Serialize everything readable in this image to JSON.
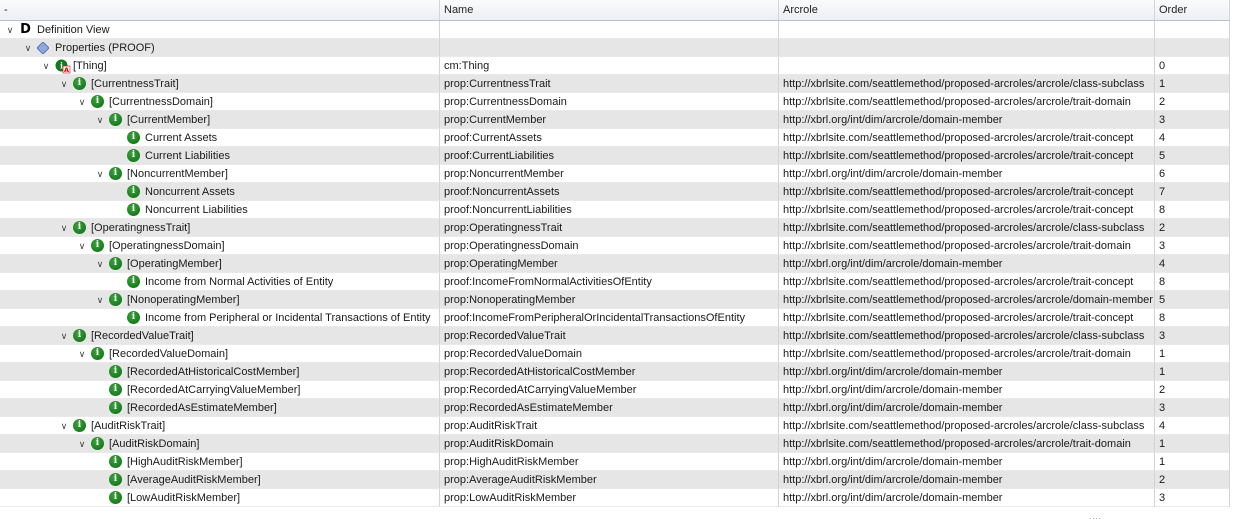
{
  "header": {
    "col_tree": "-",
    "col_name": "Name",
    "col_arcrole": "Arcrole",
    "col_order": "Order"
  },
  "colors": {
    "icon_green": "#0b6b12",
    "row_alt": "#e6e6e6",
    "header_border": "#b9c3cf"
  },
  "rows": [
    {
      "label": "Definition View",
      "name": "",
      "arcrole": "",
      "order": "",
      "icon": "definition-view-icon",
      "chev": "expanded"
    },
    {
      "label": "Properties (PROOF)",
      "name": "",
      "arcrole": "",
      "order": "",
      "icon": "diamond-icon",
      "chev": "expanded"
    },
    {
      "label": "[Thing]",
      "name": "cm:Thing",
      "arcrole": "",
      "order": "0",
      "icon": "abstract-element-icon",
      "chev": "expanded"
    },
    {
      "label": "[CurrentnessTrait]",
      "name": "prop:CurrentnessTrait",
      "arcrole": "http://xbrlsite.com/seattlemethod/proposed-arcroles/arcrole/class-subclass",
      "order": "1",
      "icon": "info-icon",
      "chev": "expanded"
    },
    {
      "label": "[CurrentnessDomain]",
      "name": "prop:CurrentnessDomain",
      "arcrole": "http://xbrlsite.com/seattlemethod/proposed-arcroles/arcrole/trait-domain",
      "order": "2",
      "icon": "info-icon",
      "chev": "expanded"
    },
    {
      "label": "[CurrentMember]",
      "name": "prop:CurrentMember",
      "arcrole": "http://xbrl.org/int/dim/arcrole/domain-member",
      "order": "3",
      "icon": "info-icon",
      "chev": "expanded"
    },
    {
      "label": "Current Assets",
      "name": "proof:CurrentAssets",
      "arcrole": "http://xbrlsite.com/seattlemethod/proposed-arcroles/arcrole/trait-concept",
      "order": "4",
      "icon": "info-icon",
      "chev": ""
    },
    {
      "label": "Current Liabilities",
      "name": "proof:CurrentLiabilities",
      "arcrole": "http://xbrlsite.com/seattlemethod/proposed-arcroles/arcrole/trait-concept",
      "order": "5",
      "icon": "info-icon",
      "chev": ""
    },
    {
      "label": "[NoncurrentMember]",
      "name": "prop:NoncurrentMember",
      "arcrole": "http://xbrl.org/int/dim/arcrole/domain-member",
      "order": "6",
      "icon": "info-icon",
      "chev": "expanded"
    },
    {
      "label": "Noncurrent Assets",
      "name": "proof:NoncurrentAssets",
      "arcrole": "http://xbrlsite.com/seattlemethod/proposed-arcroles/arcrole/trait-concept",
      "order": "7",
      "icon": "info-icon",
      "chev": ""
    },
    {
      "label": "Noncurrent Liabilities",
      "name": "proof:NoncurrentLiabilities",
      "arcrole": "http://xbrlsite.com/seattlemethod/proposed-arcroles/arcrole/trait-concept",
      "order": "8",
      "icon": "info-icon",
      "chev": ""
    },
    {
      "label": "[OperatingnessTrait]",
      "name": "prop:OperatingnessTrait",
      "arcrole": "http://xbrlsite.com/seattlemethod/proposed-arcroles/arcrole/class-subclass",
      "order": "2",
      "icon": "info-icon",
      "chev": "expanded"
    },
    {
      "label": "[OperatingnessDomain]",
      "name": "prop:OperatingnessDomain",
      "arcrole": "http://xbrlsite.com/seattlemethod/proposed-arcroles/arcrole/trait-domain",
      "order": "3",
      "icon": "info-icon",
      "chev": "expanded"
    },
    {
      "label": "[OperatingMember]",
      "name": "prop:OperatingMember",
      "arcrole": "http://xbrl.org/int/dim/arcrole/domain-member",
      "order": "4",
      "icon": "info-icon",
      "chev": "expanded"
    },
    {
      "label": "Income from Normal Activities of Entity",
      "name": "proof:IncomeFromNormalActivitiesOfEntity",
      "arcrole": "http://xbrlsite.com/seattlemethod/proposed-arcroles/arcrole/trait-concept",
      "order": "8",
      "icon": "info-icon",
      "chev": ""
    },
    {
      "label": "[NonoperatingMember]",
      "name": "prop:NonoperatingMember",
      "arcrole": "http://xbrlsite.com/seattlemethod/proposed-arcroles/arcrole/domain-member",
      "order": "5",
      "icon": "info-icon",
      "chev": "expanded"
    },
    {
      "label": "Income from Peripheral or Incidental Transactions of Entity",
      "name": "proof:IncomeFromPeripheralOrIncidentalTransactionsOfEntity",
      "arcrole": "http://xbrlsite.com/seattlemethod/proposed-arcroles/arcrole/trait-concept",
      "order": "8",
      "icon": "info-icon",
      "chev": ""
    },
    {
      "label": "[RecordedValueTrait]",
      "name": "prop:RecordedValueTrait",
      "arcrole": "http://xbrlsite.com/seattlemethod/proposed-arcroles/arcrole/class-subclass",
      "order": "3",
      "icon": "info-icon",
      "chev": "expanded"
    },
    {
      "label": "[RecordedValueDomain]",
      "name": "prop:RecordedValueDomain",
      "arcrole": "http://xbrlsite.com/seattlemethod/proposed-arcroles/arcrole/trait-domain",
      "order": "1",
      "icon": "info-icon",
      "chev": "expanded"
    },
    {
      "label": "[RecordedAtHistoricalCostMember]",
      "name": "prop:RecordedAtHistoricalCostMember",
      "arcrole": "http://xbrl.org/int/dim/arcrole/domain-member",
      "order": "1",
      "icon": "info-icon",
      "chev": ""
    },
    {
      "label": "[RecordedAtCarryingValueMember]",
      "name": "prop:RecordedAtCarryingValueMember",
      "arcrole": "http://xbrl.org/int/dim/arcrole/domain-member",
      "order": "2",
      "icon": "info-icon",
      "chev": ""
    },
    {
      "label": "[RecordedAsEstimateMember]",
      "name": "prop:RecordedAsEstimateMember",
      "arcrole": "http://xbrl.org/int/dim/arcrole/domain-member",
      "order": "3",
      "icon": "info-icon",
      "chev": ""
    },
    {
      "label": "[AuditRiskTrait]",
      "name": "prop:AuditRiskTrait",
      "arcrole": "http://xbrlsite.com/seattlemethod/proposed-arcroles/arcrole/class-subclass",
      "order": "4",
      "icon": "info-icon",
      "chev": "expanded"
    },
    {
      "label": "[AuditRiskDomain]",
      "name": "prop:AuditRiskDomain",
      "arcrole": "http://xbrlsite.com/seattlemethod/proposed-arcroles/arcrole/trait-domain",
      "order": "1",
      "icon": "info-icon",
      "chev": "expanded"
    },
    {
      "label": "[HighAuditRiskMember]",
      "name": "prop:HighAuditRiskMember",
      "arcrole": "http://xbrl.org/int/dim/arcrole/domain-member",
      "order": "1",
      "icon": "info-icon",
      "chev": ""
    },
    {
      "label": "[AverageAuditRiskMember]",
      "name": "prop:AverageAuditRiskMember",
      "arcrole": "http://xbrl.org/int/dim/arcrole/domain-member",
      "order": "2",
      "icon": "info-icon",
      "chev": ""
    },
    {
      "label": "[LowAuditRiskMember]",
      "name": "prop:LowAuditRiskMember",
      "arcrole": "http://xbrl.org/int/dim/arcrole/domain-member",
      "order": "3",
      "icon": "info-icon",
      "chev": ""
    }
  ],
  "scroll_hint": "...."
}
